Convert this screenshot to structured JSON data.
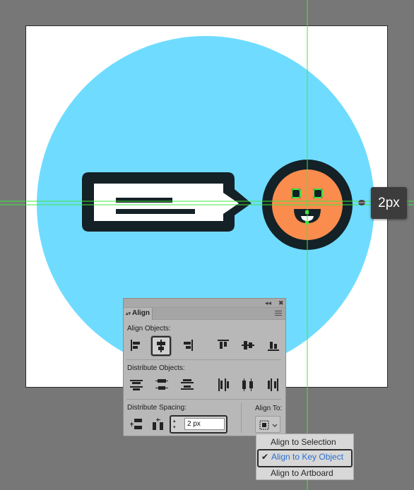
{
  "canvas": {
    "background_color": "#777777",
    "artboard_color": "#ffffff",
    "circle_color": "#6fdcff",
    "bubble_color": "#142126",
    "face_color": "#fa8c4e",
    "guide_color": "#3fe83f"
  },
  "measure_tooltip": {
    "text": "2px"
  },
  "align_panel": {
    "tab_label": "Align",
    "align_objects_label": "Align Objects:",
    "distribute_objects_label": "Distribute Objects:",
    "distribute_spacing_label": "Distribute Spacing:",
    "align_to_label": "Align To:",
    "spacing_value": "2 px",
    "collapse_icon": "double-chevron-left-icon",
    "close_icon": "close-icon",
    "menu_icon": "hamburger-menu-icon"
  },
  "align_to_menu": {
    "items": [
      {
        "label": "Align to Selection",
        "checked": false
      },
      {
        "label": "Align to Key Object",
        "checked": true
      },
      {
        "label": "Align to Artboard",
        "checked": false
      }
    ],
    "check_glyph": "✔"
  }
}
